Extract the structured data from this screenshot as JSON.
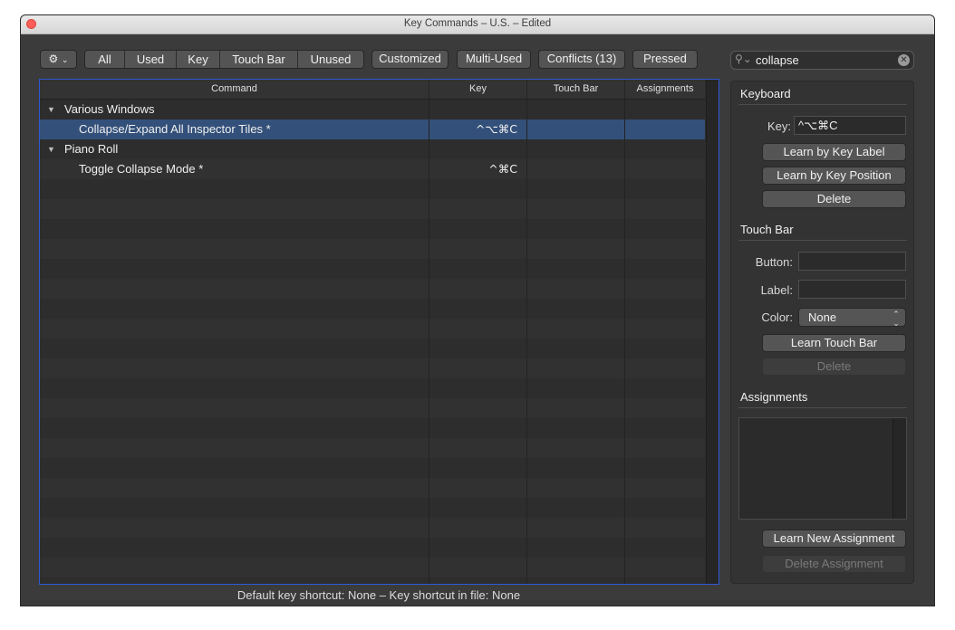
{
  "window": {
    "title": "Key Commands – U.S. – Edited"
  },
  "toolbar": {
    "gear_icon": "gear-icon",
    "filters": [
      "All",
      "Used",
      "Key",
      "Touch Bar",
      "Unused"
    ],
    "customized": "Customized",
    "multi_used": "Multi-Used",
    "conflicts": "Conflicts (13)",
    "pressed": "Pressed"
  },
  "search": {
    "value": "collapse"
  },
  "table": {
    "columns": [
      "Command",
      "Key",
      "Touch Bar",
      "Assignments"
    ],
    "rows": [
      {
        "type": "group",
        "label": "Various Windows"
      },
      {
        "type": "command",
        "label": "Collapse/Expand All Inspector Tiles *",
        "key": "^⌥⌘C",
        "selected": true
      },
      {
        "type": "group",
        "label": "Piano Roll"
      },
      {
        "type": "command",
        "label": "Toggle Collapse Mode *",
        "key": "^⌘C"
      }
    ]
  },
  "status": "Default key shortcut: None – Key shortcut in file: None",
  "keyboard": {
    "title": "Keyboard",
    "key_label": "Key:",
    "key_value": "^⌥⌘C",
    "learn_label": "Learn by Key Label",
    "learn_position": "Learn by Key Position",
    "delete": "Delete"
  },
  "touchbar": {
    "title": "Touch Bar",
    "button_label": "Button:",
    "label_label": "Label:",
    "color_label": "Color:",
    "color_value": "None",
    "learn": "Learn Touch Bar",
    "delete": "Delete"
  },
  "assignments": {
    "title": "Assignments",
    "learn_new": "Learn New Assignment",
    "delete": "Delete Assignment"
  },
  "colors": {
    "selection": "#33507a",
    "focus_ring": "#2f58d6"
  }
}
